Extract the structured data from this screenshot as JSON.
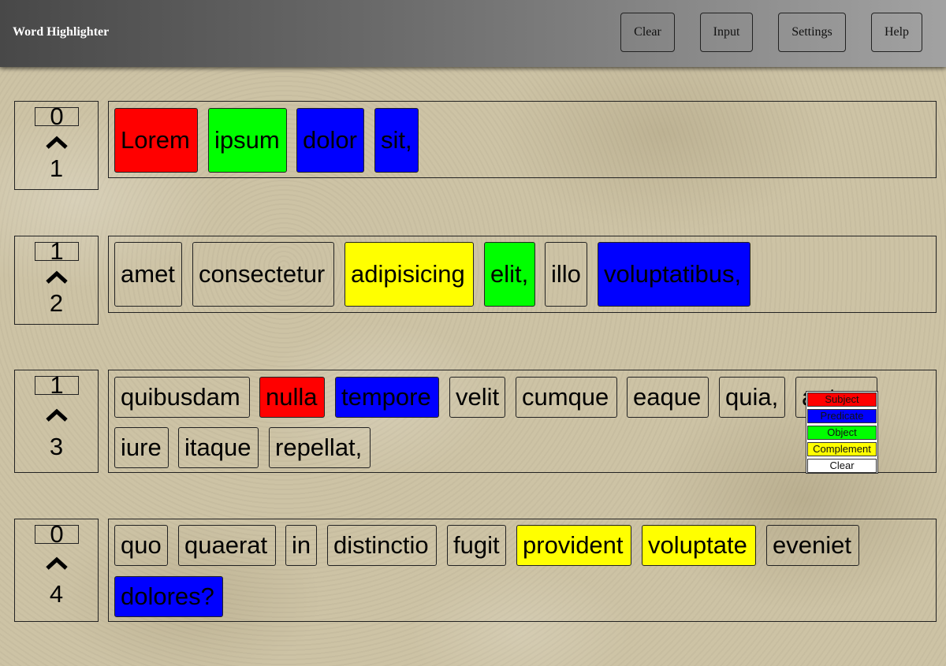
{
  "app": {
    "title": "Word Highlighter",
    "buttons": {
      "clear": "Clear",
      "input": "Input",
      "settings": "Settings",
      "help": "Help"
    }
  },
  "colors": {
    "subject": "#ff0000",
    "predicate": "#0000ff",
    "object": "#00ff00",
    "complement": "#ffff00"
  },
  "rows": [
    {
      "indent": "0",
      "index": "1",
      "words": [
        {
          "text": "Lorem",
          "role": "subject"
        },
        {
          "text": "ipsum",
          "role": "object"
        },
        {
          "text": "dolor",
          "role": "predicate"
        },
        {
          "text": "sit,",
          "role": "predicate"
        }
      ]
    },
    {
      "indent": "1",
      "index": "2",
      "words": [
        {
          "text": "amet",
          "role": "none"
        },
        {
          "text": "consectetur",
          "role": "none"
        },
        {
          "text": "adipisicing",
          "role": "complement"
        },
        {
          "text": "elit,",
          "role": "object"
        },
        {
          "text": "illo",
          "role": "none"
        },
        {
          "text": "voluptatibus,",
          "role": "predicate"
        }
      ]
    },
    {
      "indent": "1",
      "index": "3",
      "words": [
        {
          "text": "quibusdam",
          "role": "none"
        },
        {
          "text": "nulla",
          "role": "subject"
        },
        {
          "text": "tempore",
          "role": "predicate"
        },
        {
          "text": "velit",
          "role": "none"
        },
        {
          "text": "cumque",
          "role": "none"
        },
        {
          "text": "eaque",
          "role": "none"
        },
        {
          "text": "quia,",
          "role": "none"
        },
        {
          "text": "autem",
          "role": "none"
        },
        {
          "text": "iure",
          "role": "none"
        },
        {
          "text": "itaque",
          "role": "none"
        },
        {
          "text": "repellat,",
          "role": "none"
        }
      ]
    },
    {
      "indent": "0",
      "index": "4",
      "words": [
        {
          "text": "quo",
          "role": "none"
        },
        {
          "text": "quaerat",
          "role": "none"
        },
        {
          "text": "in",
          "role": "none"
        },
        {
          "text": "distinctio",
          "role": "none"
        },
        {
          "text": "fugit",
          "role": "none"
        },
        {
          "text": "provident",
          "role": "complement"
        },
        {
          "text": "voluptate",
          "role": "complement"
        },
        {
          "text": "eveniet",
          "role": "none"
        },
        {
          "text": "dolores?",
          "role": "predicate"
        }
      ]
    }
  ],
  "role_menu": {
    "items": [
      {
        "label": "Subject",
        "role": "subject"
      },
      {
        "label": "Predicate",
        "role": "predicate"
      },
      {
        "label": "Object",
        "role": "object"
      },
      {
        "label": "Complement",
        "role": "complement"
      },
      {
        "label": "Clear",
        "role": "none"
      }
    ]
  }
}
